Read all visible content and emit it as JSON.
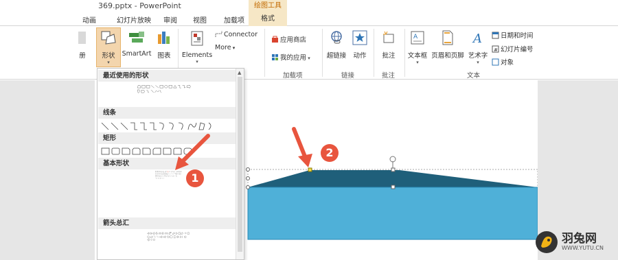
{
  "window": {
    "filename": "369.pptx - PowerPoint",
    "context_group": "绘图工具"
  },
  "tabs": [
    "动画",
    "幻灯片放映",
    "审阅",
    "视图",
    "加载项",
    "格式"
  ],
  "ribbon": {
    "partial_left": "册",
    "shapes": "形状",
    "smartart": "SmartArt",
    "chart": "图表",
    "elements": "Elements",
    "connector": "Connector",
    "more": "More",
    "app_store": "应用商店",
    "my_apps": "我的应用",
    "addins_group": "加载项",
    "hyperlink": "超链接",
    "action": "动作",
    "links_group": "链接",
    "comment": "批注",
    "comments_group": "批注",
    "textbox": "文本框",
    "header_footer": "页眉和页脚",
    "wordart": "艺术字",
    "date_time": "日期和时间",
    "slide_number": "幻灯片编号",
    "object": "对象",
    "text_group": "文本"
  },
  "dropdown": {
    "sections": [
      "最近使用的形状",
      "线条",
      "矩形",
      "基本形状",
      "箭头总汇"
    ]
  },
  "annotations": {
    "step1": "1",
    "step2": "2"
  },
  "watermark": {
    "name": "羽兔网",
    "url": "WWW.YUTU.CN"
  },
  "colors": {
    "accent": "#e8553e",
    "trapezoid": "#1f5f7a",
    "rectangle": "#4fb0d8",
    "context_tab": "#f6e7c6"
  }
}
